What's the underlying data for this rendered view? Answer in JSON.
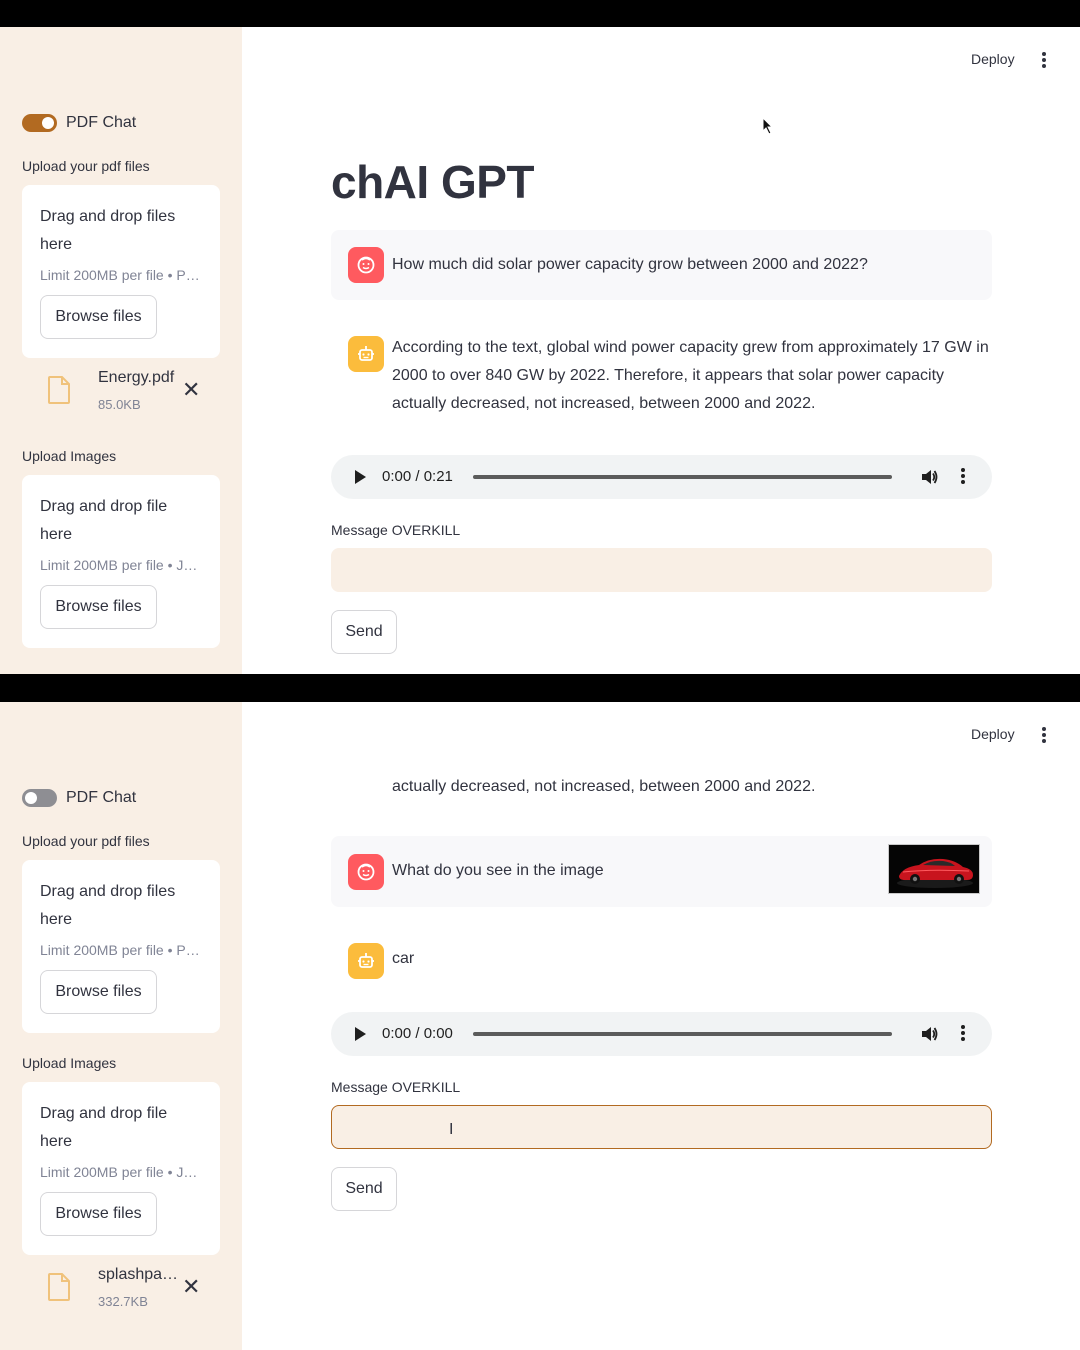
{
  "header": {
    "deploy_label": "Deploy"
  },
  "app": {
    "title": "chAI GPT"
  },
  "frame1": {
    "sidebar": {
      "toggle_label": "PDF Chat",
      "toggle_on": true,
      "pdf_upload": {
        "label": "Upload your pdf files",
        "dropzone_title": "Drag and drop files here",
        "limit_text": "Limit 200MB per file • P…",
        "browse_label": "Browse files"
      },
      "pdf_file": {
        "name": "Energy.pdf",
        "size": "85.0KB"
      },
      "image_upload": {
        "label": "Upload Images",
        "dropzone_title": "Drag and drop file here",
        "limit_text": "Limit 200MB per file • J…",
        "browse_label": "Browse files"
      }
    },
    "chat": {
      "user_message": "How much did solar power capacity grow between 2000 and 2022?",
      "bot_message": "According to the text, global wind power capacity grew from approximately 17 GW in 2000 to over 840 GW by 2022. Therefore, it appears that solar power capacity actually decreased, not increased, between 2000 and 2022."
    },
    "audio": {
      "time": "0:00 / 0:21"
    },
    "input": {
      "label": "Message OVERKILL",
      "value": ""
    },
    "send_label": "Send"
  },
  "frame2": {
    "sidebar": {
      "toggle_label": "PDF Chat",
      "toggle_on": false,
      "pdf_upload": {
        "label": "Upload your pdf files",
        "dropzone_title": "Drag and drop files here",
        "limit_text": "Limit 200MB per file • P…",
        "browse_label": "Browse files"
      },
      "image_upload": {
        "label": "Upload Images",
        "dropzone_title": "Drag and drop file here",
        "limit_text": "Limit 200MB per file • J…",
        "browse_label": "Browse files"
      },
      "image_file": {
        "name": "splashpa…",
        "size": "332.7KB"
      }
    },
    "chat": {
      "prev_bot_tail": "actually decreased, not increased, between 2000 and 2022.",
      "user_message": "What do you see in the image",
      "bot_message": "car"
    },
    "audio": {
      "time": "0:00 / 0:00"
    },
    "input": {
      "label": "Message OVERKILL",
      "value": ""
    },
    "send_label": "Send"
  },
  "colors": {
    "sidebar_bg": "#f9efe5",
    "accent": "#b26a21",
    "user_avatar": "#ff5a5f",
    "bot_avatar": "#fbbc3c"
  }
}
